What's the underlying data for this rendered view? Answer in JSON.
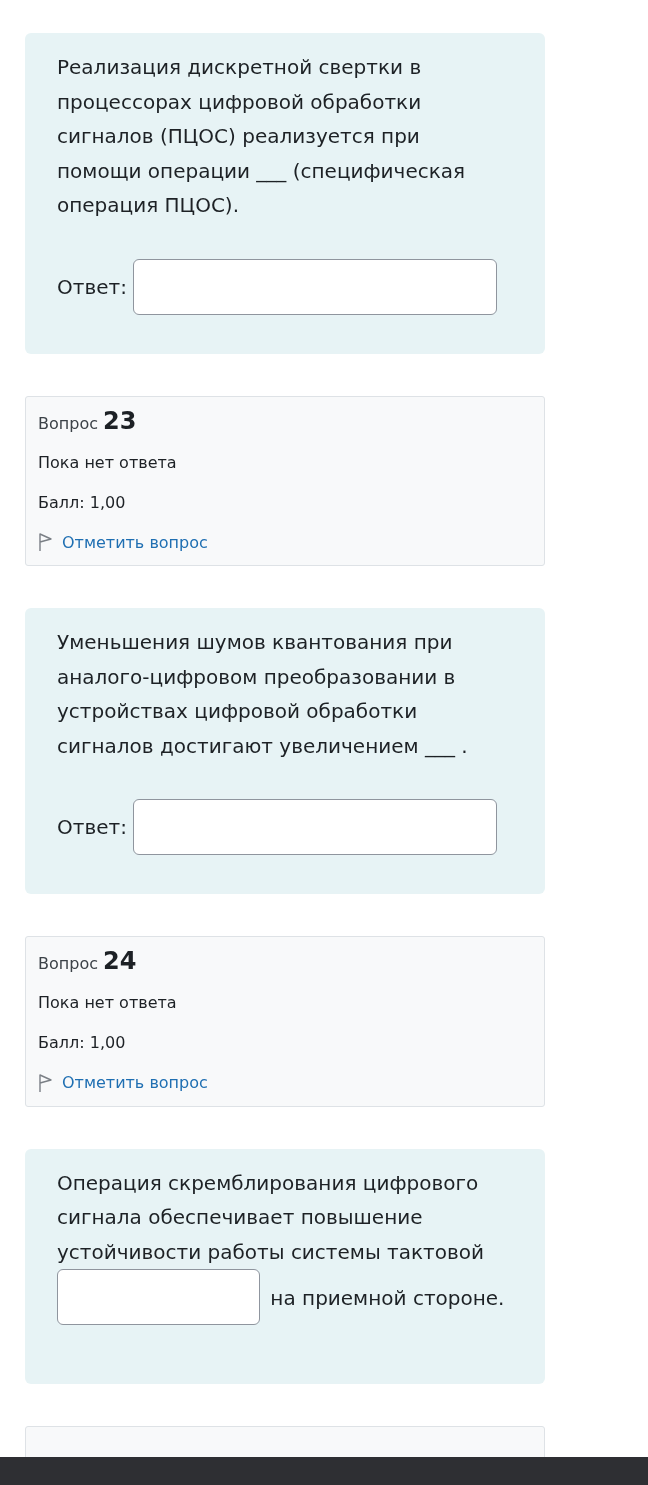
{
  "blocks": [
    {
      "kind": "answer_below",
      "text": "Реализация дискретной свертки в процессорах цифровой обработки сигналов (ПЦОС) реализуется при помощи операции ___ (специфическая операция ПЦОС).",
      "answer_label": "Ответ:"
    },
    {
      "kind": "info",
      "label": "Вопрос",
      "number": "23",
      "status": "Пока нет ответа",
      "mark": "Балл: 1,00",
      "flag_link": "Отметить вопрос"
    },
    {
      "kind": "answer_below",
      "text": "Уменьшения шумов квантования при аналого-цифровом преобразовании в устройствах цифровой обработки сигналов достигают увеличением ___ .",
      "answer_label": "Ответ:"
    },
    {
      "kind": "info",
      "label": "Вопрос",
      "number": "24",
      "status": "Пока нет ответа",
      "mark": "Балл: 1,00",
      "flag_link": "Отметить вопрос"
    },
    {
      "kind": "inline_blank",
      "text_before": "Операция скремблирования цифрового сигнала обеспечивает повышение устойчивости работы системы тактовой",
      "text_after": "на приемной стороне."
    },
    {
      "kind": "info"
    }
  ]
}
